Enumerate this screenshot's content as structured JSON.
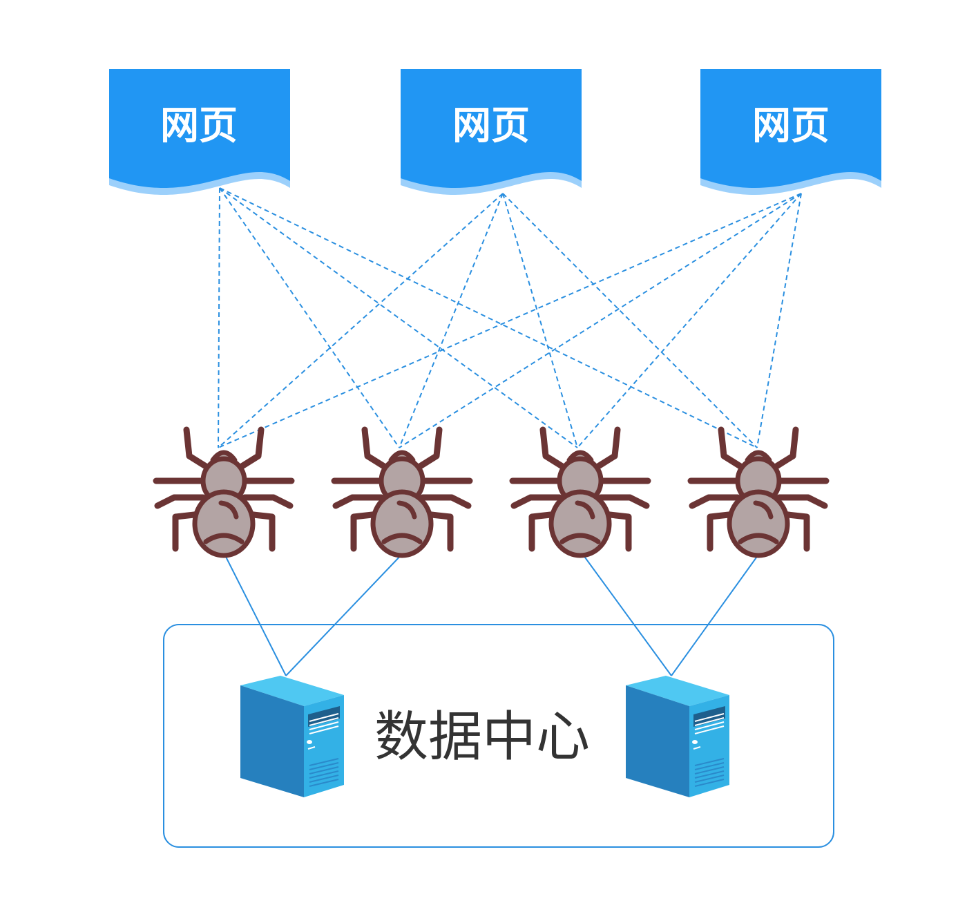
{
  "webpages": [
    {
      "label": "网页"
    },
    {
      "label": "网页"
    },
    {
      "label": "网页"
    }
  ],
  "data_center": {
    "label": "数据中心"
  },
  "colors": {
    "page_fill": "#2196F3",
    "page_wave": "#9CD0FB",
    "link_line": "#2A8FE0",
    "spider_body": "#B3A4A4",
    "spider_outline": "#6B3434",
    "server_front": "#2680BE",
    "server_side": "#33B1E6",
    "server_top": "#4FC8F2",
    "container_border": "#2A8FE0",
    "label_text": "#333333"
  },
  "icons": [
    "webpage-icon",
    "spider-icon",
    "server-icon"
  ]
}
